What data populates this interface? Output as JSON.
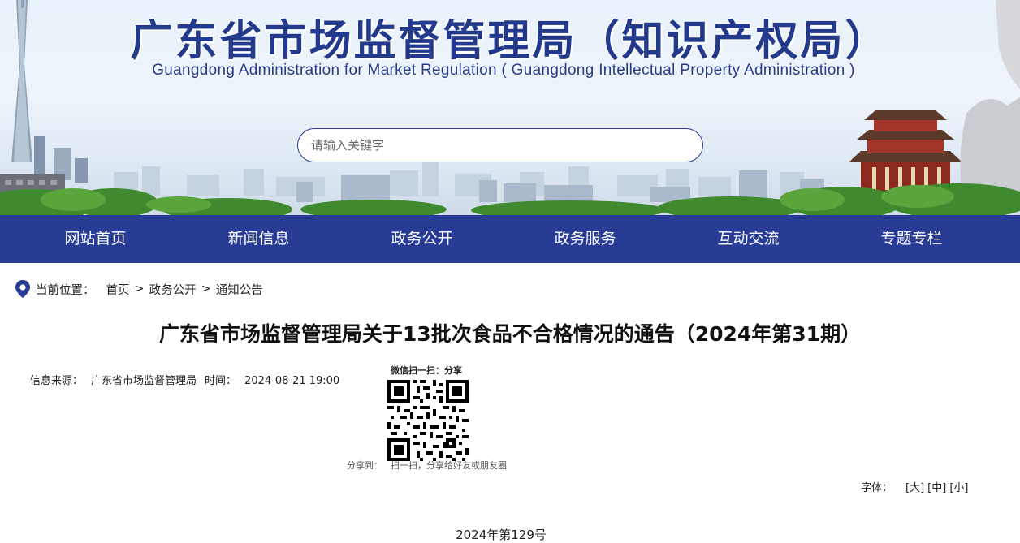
{
  "header": {
    "title_cn": "广东省市场监督管理局（知识产权局）",
    "title_en": "Guangdong Administration for Market Regulation ( Guangdong Intellectual Property Administration )",
    "search_placeholder": "请输入关键字"
  },
  "nav": {
    "items": [
      {
        "label": "网站首页"
      },
      {
        "label": "新闻信息"
      },
      {
        "label": "政务公开"
      },
      {
        "label": "政务服务"
      },
      {
        "label": "互动交流"
      },
      {
        "label": "专题专栏"
      }
    ]
  },
  "breadcrumb": {
    "label": "当前位置：",
    "items": [
      "首页",
      "政务公开",
      "通知公告"
    ],
    "separator": ">"
  },
  "article": {
    "title": "广东省市场监督管理局关于13批次食品不合格情况的通告（2024年第31期）",
    "source_label": "信息来源：",
    "source": "广东省市场监督管理局",
    "time_label": "时间：",
    "time": "2024-08-21 19:00",
    "qr_caption": "微信扫一扫：分享",
    "share_label": "分享到：",
    "share_text": "扫一扫，分享给好友或朋友圈",
    "font_label": "字体：",
    "font_options": [
      "[大]",
      "[中]",
      "[小]"
    ],
    "doc_number": "2024年第129号"
  },
  "colors": {
    "nav_bg": "#283c96",
    "title_blue": "#233a8c"
  }
}
